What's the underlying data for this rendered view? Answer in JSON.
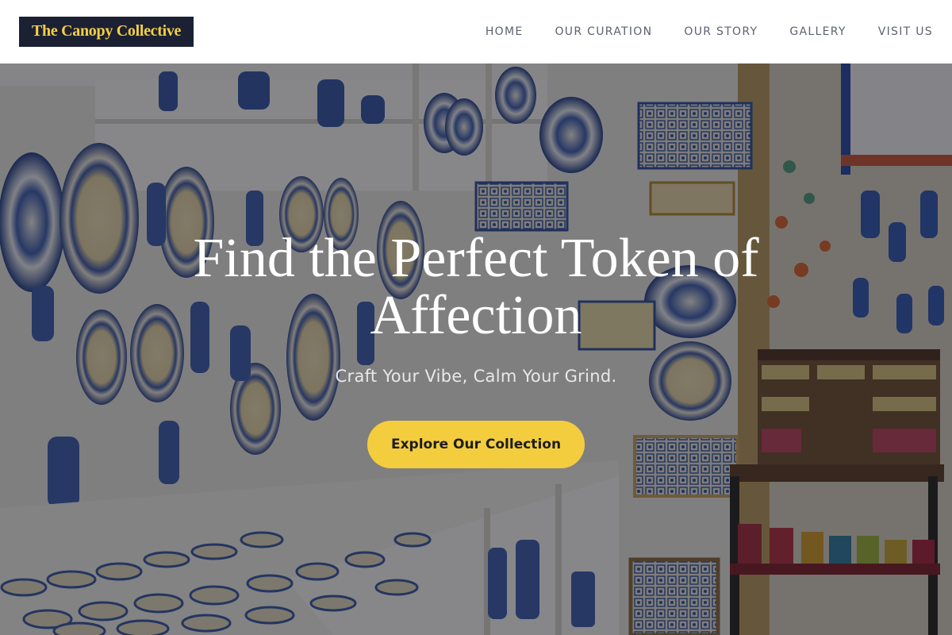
{
  "header": {
    "logo_text": "The Canopy Collective",
    "nav": [
      {
        "label": "HOME"
      },
      {
        "label": "OUR CURATION"
      },
      {
        "label": "OUR STORY"
      },
      {
        "label": "GALLERY"
      },
      {
        "label": "VISIT US"
      }
    ]
  },
  "hero": {
    "title": "Find the Perfect Token of Affection",
    "subtitle": "Craft Your Vibe, Calm Your Grind.",
    "cta_label": "Explore Our Collection",
    "background_image": "ceramics-shop-photo"
  },
  "colors": {
    "logo_bg": "#1b2033",
    "logo_text": "#f5cf45",
    "accent": "#f4cd3e",
    "nav_text": "#5c6270"
  }
}
